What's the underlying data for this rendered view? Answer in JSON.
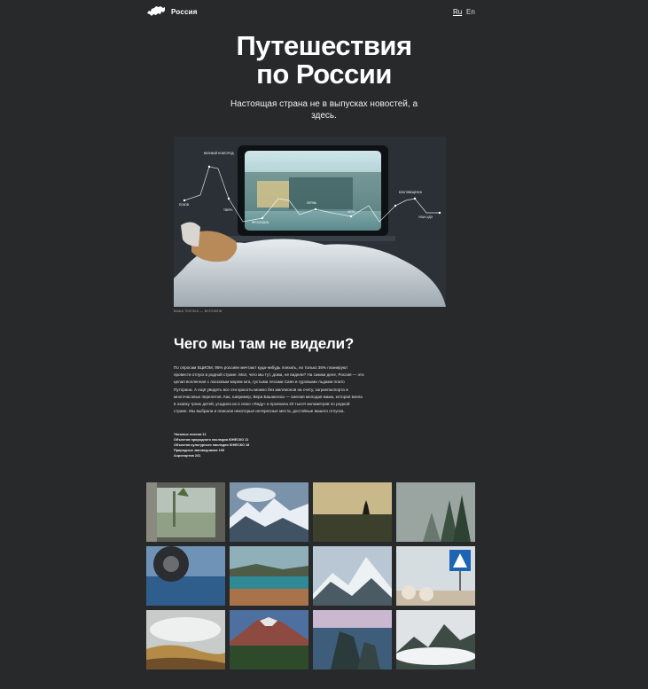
{
  "header": {
    "logo_icon": "russia-map-icon",
    "logo_text": "Россия",
    "lang_ru": "Ru",
    "lang_en": "En"
  },
  "hero": {
    "title_line1": "Путешествия",
    "title_line2": "по России",
    "subtitle": "Настоящая страна не в выпусках новостей, а здесь.",
    "photo_labels": [
      "ВЕЛИКИЙ НОВГОРОД",
      "ПСКОВ",
      "ТВЕРЬ",
      "ЯРОСЛАВЛЬ",
      "ПЕРМЬ",
      "ЧИТА",
      "БЛАГОВЕЩЕНСК",
      "УЛАН-УДЭ"
    ],
    "caption": "ВАША ПОЕЗКА — ВСПОМНИ"
  },
  "article": {
    "title": "Чего мы там не видели?",
    "body": "По опросам ВЦИОМ, 95% россиян мечтают куда-нибудь поехать, но только 36% планируют провести отпуск в родной стране. Мол, чего мы тут, дома, не видели? На самом деле, Россия — это целая вселенная с ласковым морем юга, густыми лесами Саян и суровыми льдами плато Путорана. А ещё увидеть все эти красоты можно без миллионов на счету, загранпаспорта и многочасовых перелетов. Как, например, Вера Башакеска — смелая молодая мама, которая взяла в охапку троих детей, усадила их в свою «Ладу» и проехала 20 тысяч километров по родной стране. Мы выбрали и описали некоторые интересные места, достойные вашего отпуска.",
    "stats": [
      "Часовых поясов 11",
      "Объектов природного наследия ЮНЕСКО 11",
      "Объектов культурного наследия ЮНЕСКО 18",
      "Природных заповедников 105",
      "Аэропортов 241"
    ]
  },
  "gallery": {
    "tiles": [
      "train-window-photo",
      "snow-mountains-clouds-photo",
      "sunset-dog-photo",
      "misty-forest-photo",
      "car-wheel-ice-photo",
      "lake-shore-photo",
      "snowy-peak-photo",
      "road-sign-photo",
      "hot-springs-photo",
      "volcano-photo",
      "coastal-cliffs-photo",
      "mountain-clouds-photo"
    ]
  },
  "colors": {
    "background": "#28292b",
    "text": "#ffffff"
  }
}
